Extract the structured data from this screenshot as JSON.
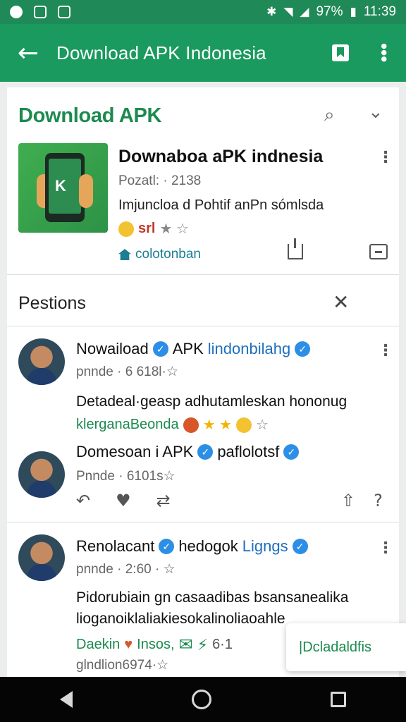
{
  "status_bar": {
    "battery": "97%",
    "time": "11:39",
    "icons": [
      "notification-icon",
      "gallery-icon",
      "app-icon",
      "bluetooth-icon",
      "wifi-icon",
      "signal-icon",
      "battery-icon"
    ]
  },
  "app_bar": {
    "title": "Download APK Indonesia",
    "back_icon": "back-arrow-icon",
    "bookmark_icon": "bookmark-icon",
    "menu_icon": "more-vert-icon",
    "color": "#1a9a5e"
  },
  "app_card": {
    "heading": "Download APK",
    "title": "Downaboa aPK indnesia",
    "meta": "Pozatl: · 2138",
    "description": "Imjuncloa d Pohtif anPn sómlsda",
    "rating_label": "srl",
    "link": "colotonban"
  },
  "section": {
    "title": "Pestions"
  },
  "posts": [
    {
      "name": "Nowaiload",
      "name_tail": "APK",
      "name_accent": "lindonbilahg",
      "meta": "pnnde · 6 618l·☆",
      "body": "Detadeal·geasp adhutamleskan hononug",
      "tags": "klerganaBeonda"
    },
    {
      "name": "Domesoan i APK",
      "name_tail": "paflolotsf",
      "meta": "Pnnde · 6101s☆"
    },
    {
      "name": "Renolacant",
      "name_tail": "hedogok",
      "name_accent": "Ligngs",
      "meta": "pnnde · 2:60 · ☆",
      "body": "Pidorubiain gn casaadibas bsansanealika",
      "body2": "lioganoiklaliakiesokalinoliaoahle",
      "tags": "Daekin",
      "tags2": "Insos,",
      "tags3": "6·1",
      "footer": "glndlion6974·☆"
    }
  ],
  "toast": {
    "label": "|Dcladaldfis"
  },
  "colors": {
    "primary": "#1a9a5e",
    "status": "#1f8a57",
    "verified": "#2d8ee6"
  }
}
